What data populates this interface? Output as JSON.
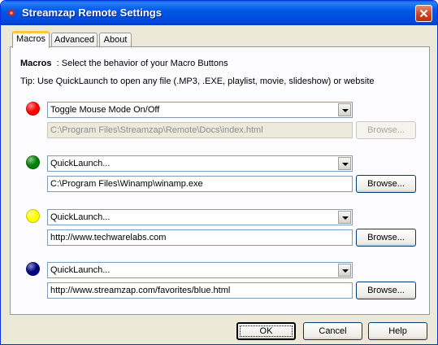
{
  "window": {
    "title": "Streamzap Remote Settings"
  },
  "tabs": [
    "Macros",
    "Advanced",
    "About"
  ],
  "macros": {
    "heading_label": "Macros",
    "heading_desc": ": Select the behavior of your Macro Buttons",
    "tip": "Tip: Use QuickLaunch to open any file (.MP3, .EXE, playlist, movie, slideshow) or website",
    "browse_label": "Browse...",
    "rows": [
      {
        "color": "red",
        "color_hex": "#ff0000",
        "action": "Toggle Mouse Mode On/Off",
        "path": "C:\\Program Files\\Streamzap\\Remote\\Docs\\index.html",
        "enabled": false
      },
      {
        "color": "green",
        "color_hex": "#008000",
        "action": "QuickLaunch...",
        "path": "C:\\Program Files\\Winamp\\winamp.exe",
        "enabled": true
      },
      {
        "color": "yellow",
        "color_hex": "#ffff00",
        "action": "QuickLaunch...",
        "path": "http://www.techwarelabs.com",
        "enabled": true
      },
      {
        "color": "blue",
        "color_hex": "#000080",
        "action": "QuickLaunch...",
        "path": "http://www.streamzap.com/favorites/blue.html",
        "enabled": true
      }
    ]
  },
  "buttons": {
    "ok": "OK",
    "cancel": "Cancel",
    "help": "Help"
  }
}
